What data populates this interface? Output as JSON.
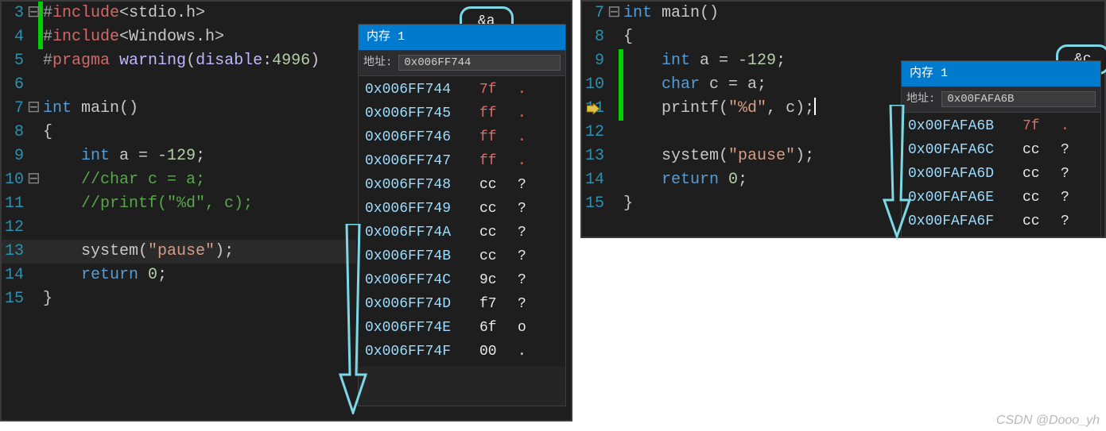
{
  "watermark": "CSDN @Dooo_yh",
  "left": {
    "bubble": "&a",
    "mem": {
      "title": "内存 1",
      "addr_label": "地址:",
      "addr_value": "0x006FF744",
      "rows": [
        {
          "addr": "0x006FF744",
          "byte": "7f",
          "cls": "red",
          "asc": ".",
          "ared": "red"
        },
        {
          "addr": "0x006FF745",
          "byte": "ff",
          "cls": "red",
          "asc": ".",
          "ared": "red"
        },
        {
          "addr": "0x006FF746",
          "byte": "ff",
          "cls": "red",
          "asc": ".",
          "ared": "red"
        },
        {
          "addr": "0x006FF747",
          "byte": "ff",
          "cls": "red",
          "asc": ".",
          "ared": "red"
        },
        {
          "addr": "0x006FF748",
          "byte": "cc",
          "cls": "wht",
          "asc": "?",
          "ared": ""
        },
        {
          "addr": "0x006FF749",
          "byte": "cc",
          "cls": "wht",
          "asc": "?",
          "ared": ""
        },
        {
          "addr": "0x006FF74A",
          "byte": "cc",
          "cls": "wht",
          "asc": "?",
          "ared": ""
        },
        {
          "addr": "0x006FF74B",
          "byte": "cc",
          "cls": "wht",
          "asc": "?",
          "ared": ""
        },
        {
          "addr": "0x006FF74C",
          "byte": "9c",
          "cls": "wht",
          "asc": "?",
          "ared": ""
        },
        {
          "addr": "0x006FF74D",
          "byte": "f7",
          "cls": "wht",
          "asc": "?",
          "ared": ""
        },
        {
          "addr": "0x006FF74E",
          "byte": "6f",
          "cls": "wht",
          "asc": "o",
          "ared": ""
        },
        {
          "addr": "0x006FF74F",
          "byte": "00",
          "cls": "wht",
          "asc": ".",
          "ared": ""
        }
      ]
    },
    "lines": [
      {
        "n": "3",
        "fold": "⊟",
        "bar": true,
        "hl": false,
        "html": "<span class='sp'>#</span><span class='inc'>include</span><span class='incang'>&lt;stdio.h&gt;</span>"
      },
      {
        "n": "4",
        "fold": "",
        "bar": true,
        "hl": false,
        "html": "<span class='sp'>#</span><span class='inc'>include</span><span class='incang'>&lt;Windows.h&gt;</span>"
      },
      {
        "n": "5",
        "fold": "",
        "bar": false,
        "hl": false,
        "html": "<span class='sp'>#</span><span class='inc'>pragma</span><span class='pl'> </span><span class='mac'>warning</span><span class='pl'>(</span><span class='mac'>disable</span><span class='pl'>:</span><span class='num'>4996</span><span class='pl'>)</span>"
      },
      {
        "n": "6",
        "fold": "",
        "bar": false,
        "hl": false,
        "html": "<span class='pl'> </span>"
      },
      {
        "n": "7",
        "fold": "⊟",
        "bar": false,
        "hl": false,
        "html": "<span class='kw'>int</span><span class='pl'> </span><span class='fn'>main</span><span class='pl'>()</span>"
      },
      {
        "n": "8",
        "fold": "",
        "bar": false,
        "hl": false,
        "html": "<span class='pl'>{</span>"
      },
      {
        "n": "9",
        "fold": "",
        "bar": false,
        "hl": false,
        "html": "<span class='pl'>    </span><span class='kw'>int</span><span class='pl'> a = </span><span class='num'>-129</span><span class='pl'>;</span>"
      },
      {
        "n": "10",
        "fold": "⊟",
        "bar": false,
        "hl": false,
        "html": "<span class='pl'>    </span><span class='cmt'>//char c = a;</span>"
      },
      {
        "n": "11",
        "fold": "",
        "bar": false,
        "hl": false,
        "html": "<span class='pl'>    </span><span class='cmt'>//printf(\"%d\", c);</span>"
      },
      {
        "n": "12",
        "fold": "",
        "bar": false,
        "hl": false,
        "html": "<span class='pl'> </span>"
      },
      {
        "n": "13",
        "fold": "",
        "bar": false,
        "hl": true,
        "html": "<span class='pl'>    </span><span class='fn'>system</span><span class='pl'>(</span><span class='str'>\"pause\"</span><span class='pl'>);</span>"
      },
      {
        "n": "14",
        "fold": "",
        "bar": false,
        "hl": false,
        "html": "<span class='pl'>    </span><span class='kw'>return</span><span class='pl'> </span><span class='num'>0</span><span class='pl'>;</span>"
      },
      {
        "n": "15",
        "fold": "",
        "bar": false,
        "hl": false,
        "html": "<span class='pl'>}</span>"
      }
    ]
  },
  "right": {
    "bubble": "&c",
    "mem": {
      "title": "内存 1",
      "addr_label": "地址:",
      "addr_value": "0x00FAFA6B",
      "rows": [
        {
          "addr": "0x00FAFA6B",
          "byte": "7f",
          "cls": "red",
          "asc": ".",
          "ared": "red"
        },
        {
          "addr": "0x00FAFA6C",
          "byte": "cc",
          "cls": "wht",
          "asc": "?",
          "ared": ""
        },
        {
          "addr": "0x00FAFA6D",
          "byte": "cc",
          "cls": "wht",
          "asc": "?",
          "ared": ""
        },
        {
          "addr": "0x00FAFA6E",
          "byte": "cc",
          "cls": "wht",
          "asc": "?",
          "ared": ""
        },
        {
          "addr": "0x00FAFA6F",
          "byte": "cc",
          "cls": "wht",
          "asc": "?",
          "ared": ""
        }
      ]
    },
    "lines": [
      {
        "n": "7",
        "fold": "⊟",
        "bar": false,
        "hl": false,
        "bp": false,
        "html": "<span class='kw'>int</span><span class='pl'> </span><span class='fn'>main</span><span class='pl'>()</span>"
      },
      {
        "n": "8",
        "fold": "",
        "bar": false,
        "hl": false,
        "bp": false,
        "html": "<span class='pl'>{</span>"
      },
      {
        "n": "9",
        "fold": "",
        "bar": true,
        "hl": false,
        "bp": false,
        "html": "<span class='pl'>    </span><span class='kw'>int</span><span class='pl'> a = </span><span class='num'>-129</span><span class='pl'>;</span>"
      },
      {
        "n": "10",
        "fold": "",
        "bar": true,
        "hl": false,
        "bp": false,
        "html": "<span class='pl'>    </span><span class='kw'>char</span><span class='pl'> c = a;</span>"
      },
      {
        "n": "11",
        "fold": "",
        "bar": true,
        "hl": false,
        "bp": true,
        "html": "<span class='pl'>    </span><span class='fn'>printf</span><span class='pl'>(</span><span class='str'>\"%d\"</span><span class='pl'>, c);</span><span class='cursor'></span>"
      },
      {
        "n": "12",
        "fold": "",
        "bar": false,
        "hl": false,
        "bp": false,
        "html": "<span class='pl'> </span>"
      },
      {
        "n": "13",
        "fold": "",
        "bar": false,
        "hl": false,
        "bp": false,
        "html": "<span class='pl'>    </span><span class='fn'>system</span><span class='pl'>(</span><span class='str'>\"pause\"</span><span class='pl'>);</span>"
      },
      {
        "n": "14",
        "fold": "",
        "bar": false,
        "hl": false,
        "bp": false,
        "html": "<span class='pl'>    </span><span class='kw'>return</span><span class='pl'> </span><span class='num'>0</span><span class='pl'>;</span>"
      },
      {
        "n": "15",
        "fold": "",
        "bar": false,
        "hl": false,
        "bp": false,
        "html": "<span class='pl'>}</span>"
      }
    ]
  }
}
